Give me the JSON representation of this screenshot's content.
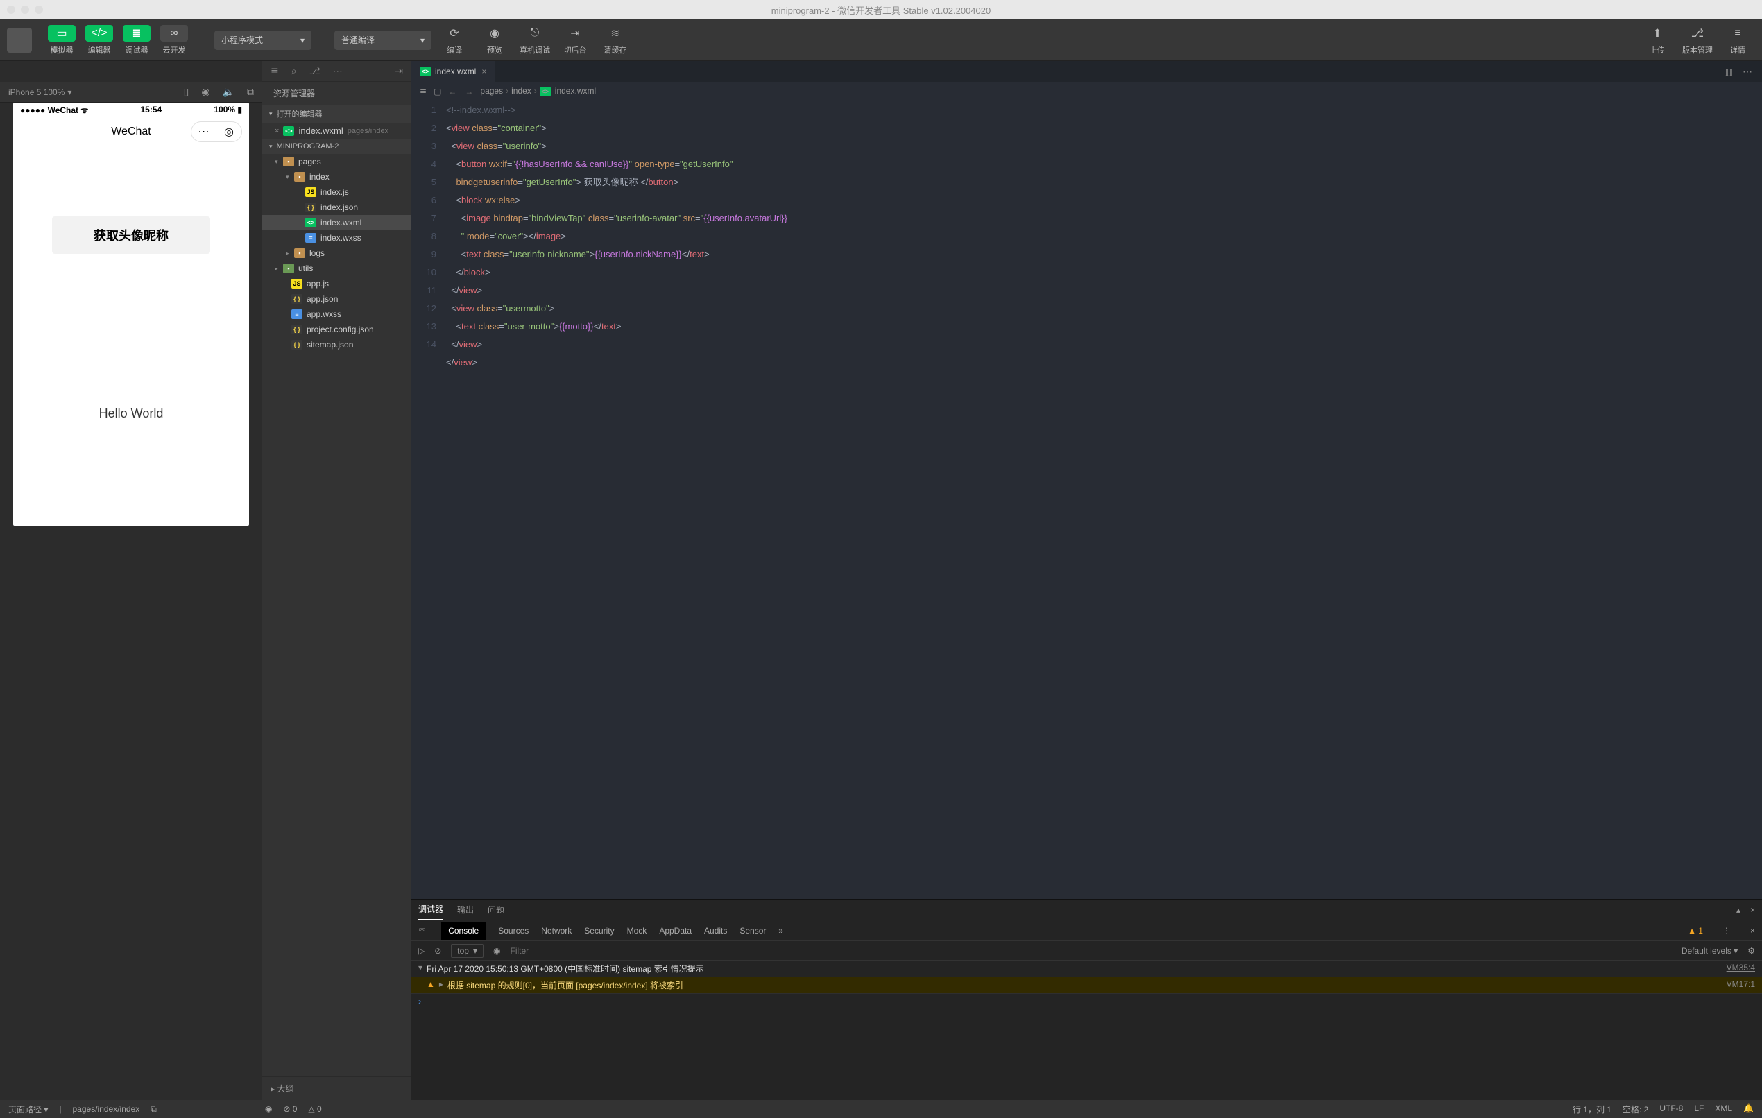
{
  "window": {
    "title": "miniprogram-2 - 微信开发者工具 Stable v1.02.2004020"
  },
  "toolbar": {
    "simulator": "模拟器",
    "editor": "编辑器",
    "debugger": "调试器",
    "cloud": "云开发",
    "mode_dropdown": "小程序模式",
    "compile_dropdown": "普通编译",
    "compile": "编译",
    "preview": "预览",
    "real_debug": "真机调试",
    "background": "切后台",
    "clear_cache": "清缓存",
    "upload": "上传",
    "version": "版本管理",
    "details": "详情"
  },
  "device_bar": {
    "device": "iPhone 5 100%"
  },
  "phone": {
    "carrier": "WeChat",
    "time": "15:54",
    "battery": "100%",
    "nav_title": "WeChat",
    "get_user_btn": "获取头像昵称",
    "hello": "Hello World"
  },
  "explorer": {
    "title": "资源管理器",
    "open_editors": "打开的编辑器",
    "project": "MINIPROGRAM-2",
    "open_file": "index.wxml",
    "open_file_hint": "pages/index",
    "outline": "大纲",
    "tree": {
      "pages": "pages",
      "index_dir": "index",
      "index_js": "index.js",
      "index_json": "index.json",
      "index_wxml": "index.wxml",
      "index_wxss": "index.wxss",
      "logs": "logs",
      "utils": "utils",
      "app_js": "app.js",
      "app_json": "app.json",
      "app_wxss": "app.wxss",
      "project_config": "project.config.json",
      "sitemap": "sitemap.json"
    }
  },
  "editor": {
    "tab": "index.wxml",
    "crumbs": {
      "p0": "pages",
      "p1": "index",
      "p2": "index.wxml"
    },
    "lines": [
      "1",
      "2",
      "3",
      "4",
      "5",
      "6",
      "7",
      "8",
      "9",
      "10",
      "11",
      "12",
      "13",
      "14"
    ]
  },
  "debugger": {
    "tabs": {
      "debug": "调试器",
      "output": "输出",
      "problems": "问题"
    },
    "devtabs": {
      "console": "Console",
      "sources": "Sources",
      "network": "Network",
      "security": "Security",
      "mock": "Mock",
      "appdata": "AppData",
      "audits": "Audits",
      "sensor": "Sensor"
    },
    "warn_count": "1",
    "context": "top",
    "filter_placeholder": "Filter",
    "levels": "Default levels",
    "log1": "Fri Apr 17 2020 15:50:13 GMT+0800 (中国标准时间) sitemap 索引情况提示",
    "log1_src": "VM35:4",
    "log2": "根据 sitemap 的规则[0]，当前页面 [pages/index/index] 将被索引",
    "log2_src": "VM17:1"
  },
  "statusbar": {
    "page_path_label": "页面路径",
    "page_path": "pages/index/index",
    "errors": "0",
    "warnings": "0",
    "line_col": "行 1，列 1",
    "spaces": "空格: 2",
    "encoding": "UTF-8",
    "eol": "LF",
    "lang": "XML"
  }
}
